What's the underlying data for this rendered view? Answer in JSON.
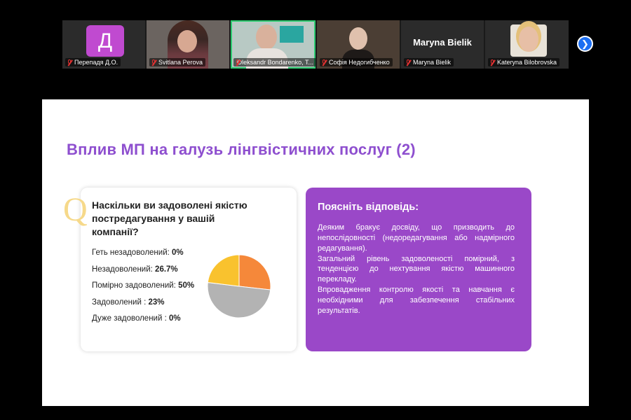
{
  "participants": [
    {
      "name": "Перепадя Д.О.",
      "avatar_letter": "Д"
    },
    {
      "name": "Svitlana Perova"
    },
    {
      "name": "Oleksandr Bondarenko, T..."
    },
    {
      "name": "Софія Недогибченко"
    },
    {
      "name": "Maryna Bielik",
      "display_name": "Maryna Bielik"
    },
    {
      "name": "Kateryna Bilobrovska"
    }
  ],
  "next_icon": "chevron-right-icon",
  "slide": {
    "title": "Вплив МП на галузь лінгвістичних послуг (2)",
    "question_mark": "Q",
    "question": "Наскільки ви задоволені якістю постредагування у вашій компанії?",
    "options": [
      {
        "label": "Геть незадоволений: ",
        "value": "0%"
      },
      {
        "label": "Незадоволений: ",
        "value": "26.7%"
      },
      {
        "label": "Помірно задоволений: ",
        "value": "50%"
      },
      {
        "label": "Задоволений : ",
        "value": "23%"
      },
      {
        "label": "Дуже задоволений : ",
        "value": "0%"
      }
    ],
    "answer_title": "Поясніть відповідь:",
    "answer_paragraphs": [
      "Деяким бракує досвіду, що призводить до непослідовності (недоредагування або надмірного редагування).",
      "Загальний рівень задоволеності помірний, з тенденцією до нехтування якістю машинного перекладу.",
      "Впровадження контролю якості та навчання є необхідними для забезпечення стабільних результатів."
    ]
  },
  "chart_data": {
    "type": "pie",
    "categories": [
      "Незадоволений",
      "Помірно задоволений",
      "Задоволений"
    ],
    "values": [
      26.7,
      50,
      23
    ],
    "colors": [
      "#f5883a",
      "#b3b3b3",
      "#f9c22e"
    ]
  }
}
